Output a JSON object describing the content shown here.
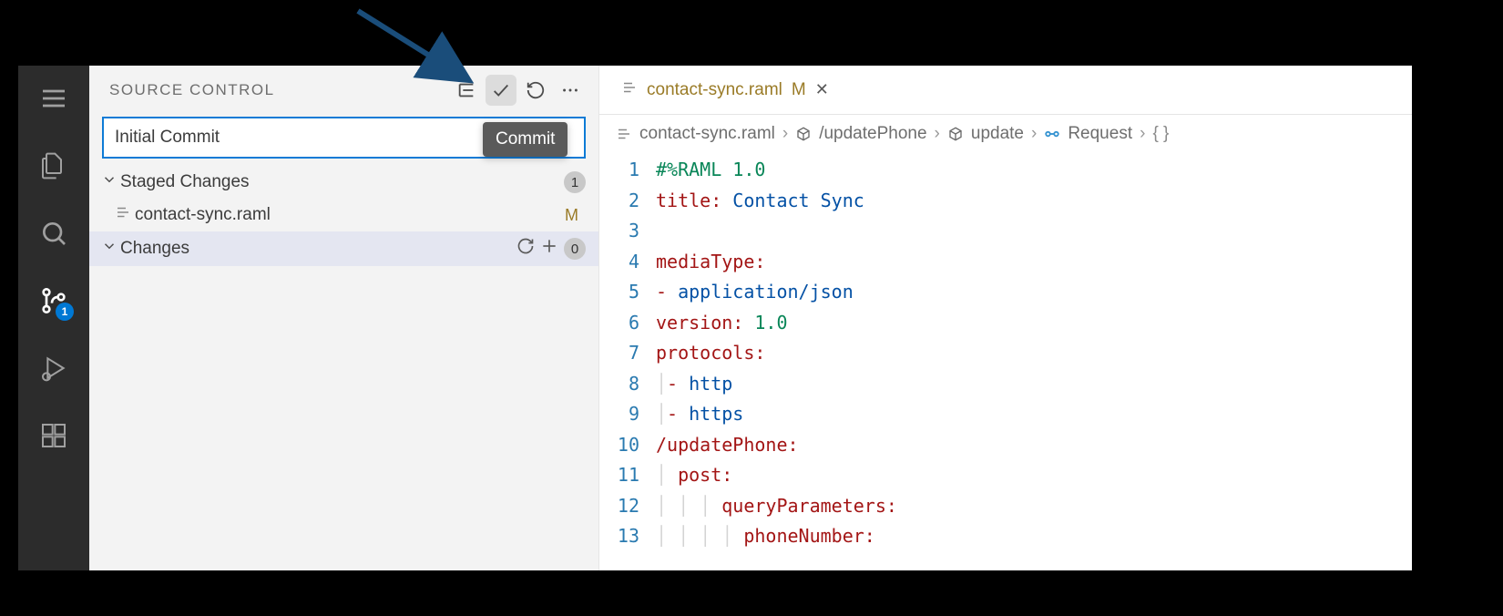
{
  "sidebar": {
    "title": "SOURCE CONTROL",
    "commit_value": "Initial Commit",
    "staged_label": "Staged Changes",
    "staged_count": "1",
    "staged_file": "contact-sync.raml",
    "staged_file_status": "M",
    "changes_label": "Changes",
    "changes_count": "0"
  },
  "activity": {
    "scm_badge": "1"
  },
  "tooltip": "Commit",
  "tab": {
    "name": "contact-sync.raml",
    "status": "M"
  },
  "breadcrumbs": {
    "b1": "contact-sync.raml",
    "b2": "/updatePhone",
    "b3": "update",
    "b4": "Request"
  },
  "code": {
    "l1a": "#%RAML 1.0",
    "l2k": "title:",
    "l2v": " Contact Sync",
    "l4k": "mediaType:",
    "l5d": "- ",
    "l5v": "application/json",
    "l6k": "version:",
    "l6v": " 1.0",
    "l7k": "protocols:",
    "l8d": "- ",
    "l8v": "http",
    "l9d": "- ",
    "l9v": "https",
    "l10k": "/updatePhone:",
    "l11k": "post:",
    "l12k": "queryParameters:",
    "l13k": "phoneNumber:"
  },
  "linenums": {
    "n1": "1",
    "n2": "2",
    "n3": "3",
    "n4": "4",
    "n5": "5",
    "n6": "6",
    "n7": "7",
    "n8": "8",
    "n9": "9",
    "n10": "10",
    "n11": "11",
    "n12": "12",
    "n13": "13"
  }
}
